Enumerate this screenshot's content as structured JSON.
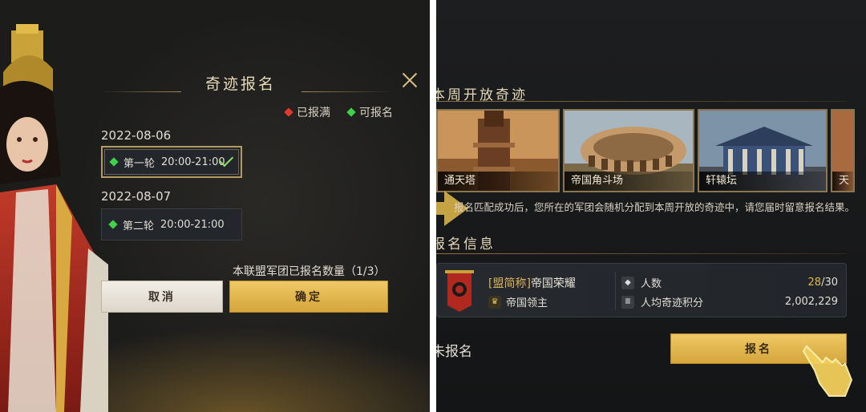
{
  "left_dialog": {
    "title": "奇迹报名",
    "legend": {
      "full": "已报满",
      "available": "可报名"
    },
    "dates": [
      {
        "date": "2022-08-06",
        "slot_label": "第一轮",
        "time": "20:00-21:00",
        "selected": true
      },
      {
        "date": "2022-08-07",
        "slot_label": "第二轮",
        "time": "20:00-21:00",
        "selected": false
      }
    ],
    "registration_count": "本联盟军团已报名数量（1/3）",
    "cancel_label": "取消",
    "confirm_label": "确定"
  },
  "right_panel": {
    "weekly_title": "本周开放奇迹",
    "wonders": [
      {
        "name": "通天塔"
      },
      {
        "name": "帝国角斗场"
      },
      {
        "name": "轩辕坛"
      },
      {
        "name": "天"
      }
    ],
    "info_text": "报名匹配成功后，您所在的军团会随机分配到本周开放的奇迹中，请您届时留意报名结果。",
    "signup_title": "报名信息",
    "alliance": {
      "tag": "[盟简称]",
      "name": "帝国荣耀",
      "leader": "帝国领主",
      "headcount_label": "人数",
      "headcount_current": "28",
      "headcount_total": "/30",
      "avg_score_label": "人均奇迹积分",
      "avg_score": "2,002,229"
    },
    "status": "未报名",
    "register_label": "报名"
  },
  "colors": {
    "gold": "#d4a63c",
    "red_dot": "#e03a2e",
    "green_dot": "#3fd24a"
  }
}
